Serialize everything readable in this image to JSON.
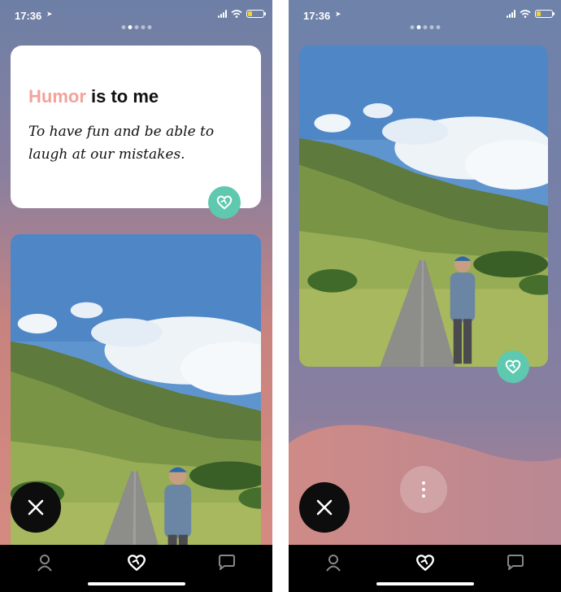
{
  "status_bar": {
    "time": "17:36"
  },
  "pagination": {
    "total": 5,
    "active_index": 1
  },
  "prompt": {
    "title_accent": "Humor",
    "title_rest": " is to me",
    "answer": "To have fun and be able to laugh at our mistakes."
  },
  "photo": {
    "subject": "man-on-country-road-in-green-valley"
  },
  "colors": {
    "accent": "#f2a39a",
    "like": "#5ec9af",
    "reject": "#0d0d0d",
    "battery": "#f5d02c"
  },
  "icons": {
    "reject": "close-icon",
    "like": "heart-icon",
    "more": "more-vertical-icon",
    "tab_profile": "profile-icon",
    "tab_matches": "heart-icon",
    "tab_chat": "chat-bubble-icon"
  },
  "tabs": [
    {
      "name": "profile",
      "active": false
    },
    {
      "name": "discover",
      "active": true
    },
    {
      "name": "messages",
      "active": false
    }
  ]
}
